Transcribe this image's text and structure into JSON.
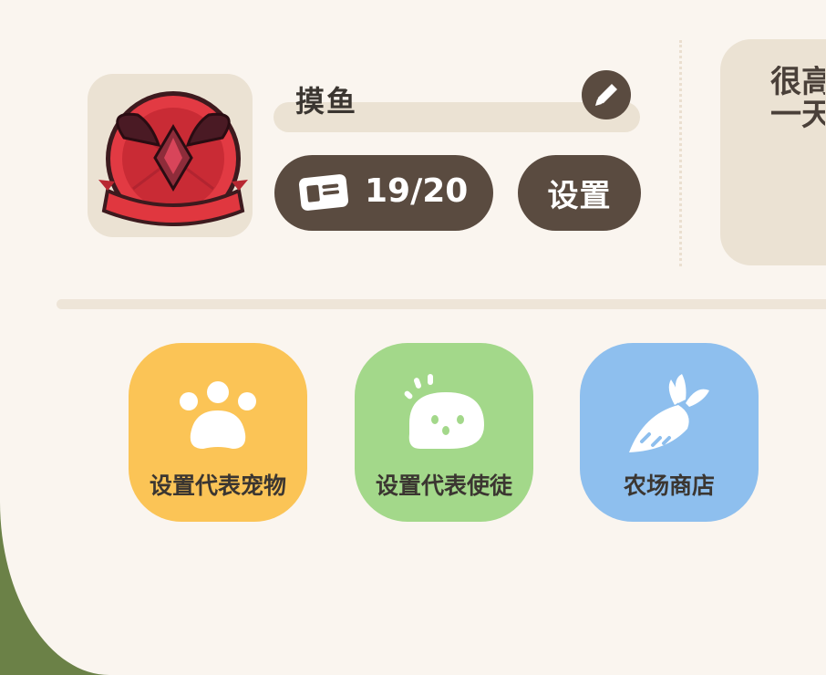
{
  "profile": {
    "name": "摸鱼",
    "avatar_icon": "winged-red-emblem-icon",
    "edit_icon": "pencil-icon",
    "card_icon": "id-card-icon",
    "card_count": "19/20",
    "settings_label": "设置"
  },
  "notice": {
    "line1": "很高",
    "line2": "一天"
  },
  "actions": [
    {
      "label": "设置代表宠物",
      "icon": "paw-icon",
      "color": "#fbc456"
    },
    {
      "label": "设置代表使徒",
      "icon": "ghost-blob-icon",
      "color": "#a3d88a"
    },
    {
      "label": "农场商店",
      "icon": "carrot-icon",
      "color": "#8ebfee"
    }
  ],
  "colors": {
    "background": "#faf5ef",
    "pill": "#5a4b40",
    "panel": "#ebe2d3",
    "outer": "#6b8147"
  }
}
